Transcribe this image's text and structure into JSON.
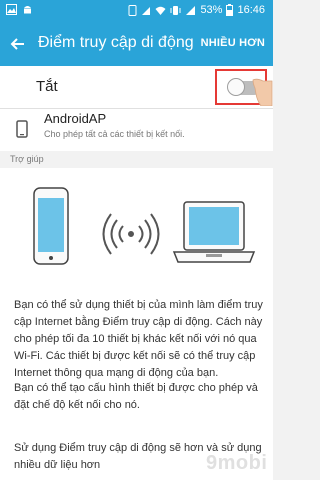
{
  "status_bar": {
    "battery_percent": "53%",
    "time": "16:46",
    "icons": [
      "gallery-icon",
      "android-icon",
      "phone-icon",
      "signal-icon",
      "wifi-icon",
      "vibrate-icon",
      "data-icon",
      "battery-icon"
    ]
  },
  "appbar": {
    "title": "Điểm truy cập di động",
    "more_label": "NHIỀU HƠN"
  },
  "toggle_row": {
    "label": "Tắt",
    "state": "off"
  },
  "ap": {
    "name": "AndroidAP",
    "description": "Cho phép tất cả các thiết bị kết nối."
  },
  "help": {
    "section_label": "Trợ giúp",
    "paragraphs": [
      "Bạn có thể sử dụng thiết bị của mình làm điểm truy cập Internet bằng Điểm truy cập di động. Cách này cho phép tối đa 10 thiết bị khác kết nối với nó qua Wi-Fi. Các thiết bị được kết nối sẽ có thể truy cập Internet thông qua mạng di động của bạn.",
      "Bạn có thể tạo cấu hình thiết bị được cho phép và đặt chế độ kết nối cho nó.",
      "Sử dụng Điểm truy cập di động sẽ hơn và sử dụng nhiều dữ liệu hơn"
    ]
  },
  "logo": {
    "text": "9mobi"
  },
  "colors": {
    "accent": "#2aa4d8",
    "highlight_border": "#e53935"
  }
}
